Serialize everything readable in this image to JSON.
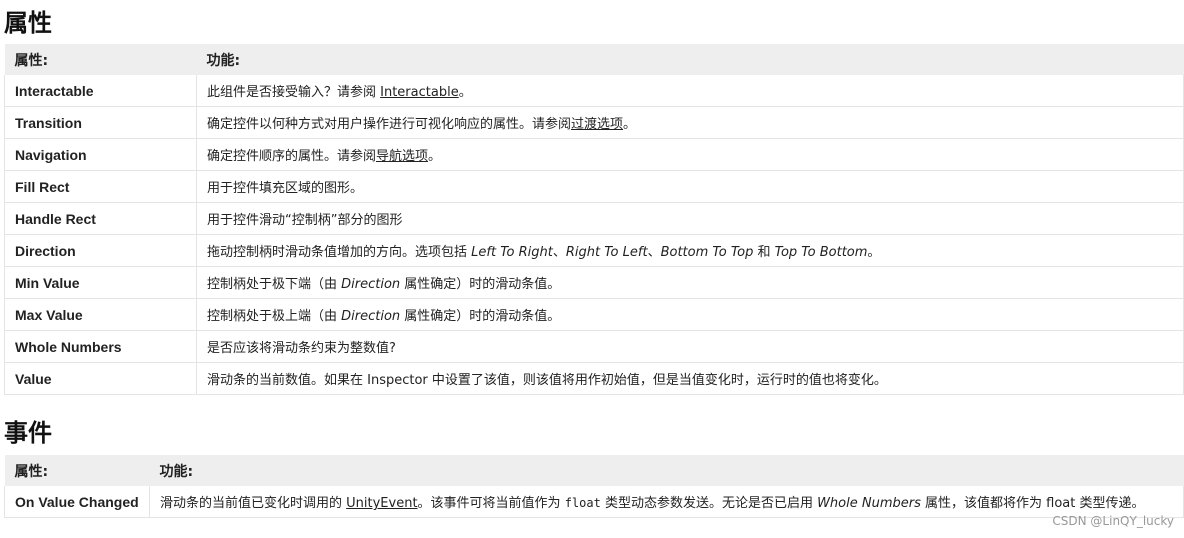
{
  "section1": {
    "title": "属性",
    "headers": [
      "属性:",
      "功能:"
    ],
    "rows": [
      {
        "name": "Interactable",
        "segments": [
          {
            "t": "此组件是否接受输入？请参阅 "
          },
          {
            "t": "Interactable",
            "link": true
          },
          {
            "t": "。"
          }
        ]
      },
      {
        "name": "Transition",
        "segments": [
          {
            "t": "确定控件以何种方式对用户操作进行可视化响应的属性。请参阅"
          },
          {
            "t": "过渡选项",
            "link": true
          },
          {
            "t": "。"
          }
        ]
      },
      {
        "name": "Navigation",
        "segments": [
          {
            "t": "确定控件顺序的属性。请参阅"
          },
          {
            "t": "导航选项",
            "link": true
          },
          {
            "t": "。"
          }
        ]
      },
      {
        "name": "Fill Rect",
        "segments": [
          {
            "t": "用于控件填充区域的图形。"
          }
        ]
      },
      {
        "name": "Handle Rect",
        "segments": [
          {
            "t": "用于控件滑动“控制柄”部分的图形"
          }
        ]
      },
      {
        "name": "Direction",
        "segments": [
          {
            "t": "拖动控制柄时滑动条值增加的方向。选项包括 "
          },
          {
            "t": "Left To Right",
            "em": true
          },
          {
            "t": "、"
          },
          {
            "t": "Right To Left",
            "em": true
          },
          {
            "t": "、"
          },
          {
            "t": "Bottom To Top",
            "em": true
          },
          {
            "t": " 和 "
          },
          {
            "t": "Top To Bottom",
            "em": true
          },
          {
            "t": "。"
          }
        ]
      },
      {
        "name": "Min Value",
        "segments": [
          {
            "t": "控制柄处于极下端（由 "
          },
          {
            "t": "Direction",
            "em": true
          },
          {
            "t": " 属性确定）时的滑动条值。"
          }
        ]
      },
      {
        "name": "Max Value",
        "segments": [
          {
            "t": "控制柄处于极上端（由 "
          },
          {
            "t": "Direction",
            "em": true
          },
          {
            "t": " 属性确定）时的滑动条值。"
          }
        ]
      },
      {
        "name": "Whole Numbers",
        "segments": [
          {
            "t": "是否应该将滑动条约束为整数值?"
          }
        ]
      },
      {
        "name": "Value",
        "segments": [
          {
            "t": "滑动条的当前数值。如果在 Inspector 中设置了该值，则该值将用作初始值，但是当值变化时，运行时的值也将变化。"
          }
        ]
      }
    ]
  },
  "section2": {
    "title": "事件",
    "headers": [
      "属性:",
      "功能:"
    ],
    "rows": [
      {
        "name": "On Value Changed",
        "segments": [
          {
            "t": "滑动条的当前值已变化时调用的 "
          },
          {
            "t": "UnityEvent",
            "link": true
          },
          {
            "t": "。该事件可将当前值作为 "
          },
          {
            "t": "float",
            "code": true
          },
          {
            "t": " 类型动态参数发送。无论是否已启用 "
          },
          {
            "t": "Whole Numbers",
            "em": true
          },
          {
            "t": " 属性，该值都将作为 float 类型传递。"
          }
        ]
      }
    ]
  },
  "watermark": "CSDN @LinQY_lucky"
}
